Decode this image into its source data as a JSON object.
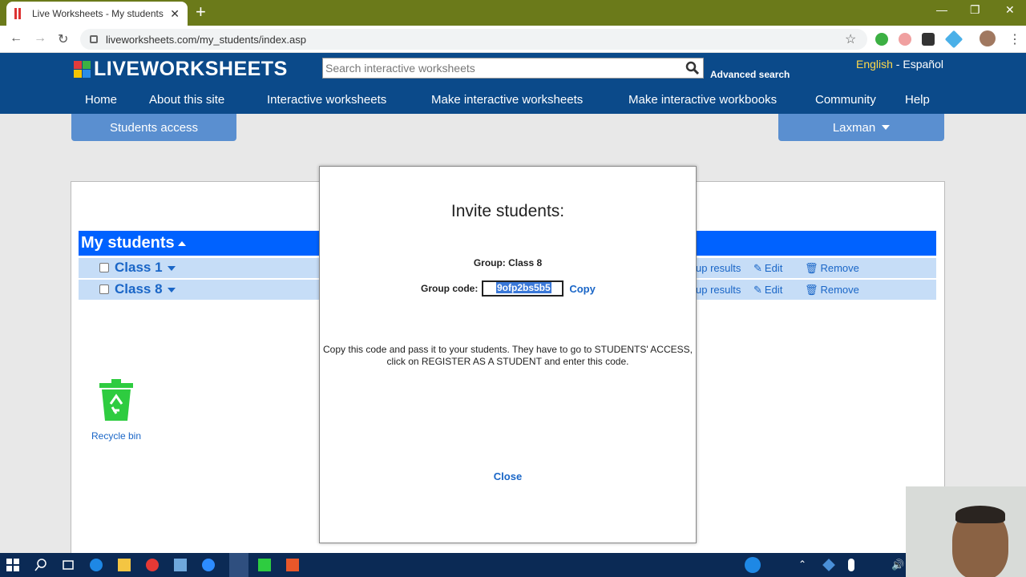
{
  "browser": {
    "tab_title": "Live Worksheets - My students",
    "tab_close": "✕",
    "new_tab": "+",
    "url": "liveworksheets.com/my_students/index.asp"
  },
  "site": {
    "logo_text": "LIVEWORKSHEETS",
    "search_placeholder": "Search interactive worksheets",
    "advanced_search": "Advanced search",
    "lang_english": "English",
    "lang_sep": " - ",
    "lang_spanish": "Español",
    "nav": [
      "Home",
      "About this site",
      "Interactive worksheets",
      "Make interactive worksheets",
      "Make interactive workbooks",
      "Community",
      "Help"
    ],
    "students_access": "Students access",
    "user_name": "Laxman"
  },
  "main": {
    "students_title": "My students",
    "classes": [
      {
        "name": "Class 1",
        "group_results": "up results",
        "edit": "Edit",
        "remove": "Remove"
      },
      {
        "name": "Class 8",
        "group_results": "up results",
        "edit": "Edit",
        "remove": "Remove"
      }
    ],
    "recycle_bin": "Recycle bin"
  },
  "modal": {
    "title": "Invite students:",
    "group_label": "Group: Class 8",
    "code_label": "Group code:",
    "code_value": "9ofp2bs5b5",
    "copy": "Copy",
    "instructions_line1": "Copy this code and pass it to your students. They have to go to STUDENTS' ACCESS,",
    "instructions_line2": "click on REGISTER AS A STUDENT and enter this code.",
    "close": "Close"
  },
  "colors": {
    "header_bg": "#0b4a8a",
    "students_bar": "#0062ff",
    "class_row": "#c6ddf7",
    "link": "#1a66c7",
    "sub_button": "#5a8fd0"
  }
}
